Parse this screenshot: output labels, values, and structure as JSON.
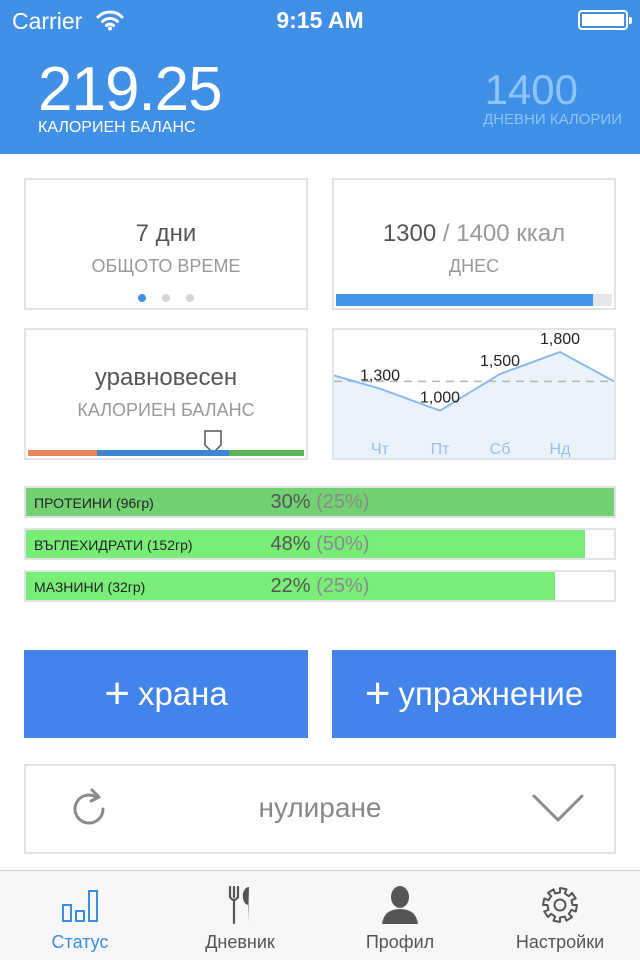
{
  "status_bar": {
    "carrier": "Carrier",
    "time": "9:15 AM"
  },
  "header": {
    "balance_value": "219.25",
    "balance_label": "КАЛОРИЕН БАЛАНС",
    "daily_value": "1400",
    "daily_label": "ДНЕВНИ КАЛОРИИ"
  },
  "cards": {
    "time": {
      "value": "7 дни",
      "label": "ОБЩОТО ВРЕМЕ",
      "page_index": 0,
      "page_count": 3
    },
    "today": {
      "current": "1300",
      "separator": " / ",
      "target": "1400 ккал",
      "label": "ДНЕС",
      "progress": 0.93
    },
    "balance": {
      "status": "уравновесен",
      "label": "КАЛОРИЕН БАЛАНС",
      "segment_colors": [
        "#e8845a",
        "#3d86d6",
        "#5db55a"
      ]
    }
  },
  "chart_data": {
    "type": "line",
    "categories": [
      "Чт",
      "Пт",
      "Сб",
      "Нд"
    ],
    "values": [
      1300,
      1000,
      1500,
      1800
    ],
    "value_labels": [
      "1,300",
      "1,000",
      "1,500",
      "1,800"
    ],
    "reference_line": 1400,
    "line_color": "#8cb8ea",
    "fill_color": "#eaf3fc"
  },
  "macros": [
    {
      "label": "ПРОТЕИНИ (96гр)",
      "percent": "30%",
      "target": "(25%)",
      "fill": 1.0,
      "color": "#72d272"
    },
    {
      "label": "ВЪГЛЕХИДРАТИ (152гр)",
      "percent": "48%",
      "target": "(50%)",
      "fill": 0.95,
      "color": "#78ee78"
    },
    {
      "label": "МАЗНИНИ (32гр)",
      "percent": "22%",
      "target": "(25%)",
      "fill": 0.9,
      "color": "#78ee78"
    }
  ],
  "actions": {
    "plus": "+",
    "food_label": "храна",
    "exercise_label": "упражнение",
    "reset_label": "нулиране"
  },
  "tabs": [
    {
      "label": "Статус",
      "icon": "bar-chart-icon",
      "active": true
    },
    {
      "label": "Дневник",
      "icon": "fork-knife-icon",
      "active": false
    },
    {
      "label": "Профил",
      "icon": "person-icon",
      "active": false
    },
    {
      "label": "Настройки",
      "icon": "gear-icon",
      "active": false
    }
  ],
  "colors": {
    "header": "#4190e8",
    "accent": "#4283ec",
    "muted_blue_text": "#8cc4fb"
  }
}
